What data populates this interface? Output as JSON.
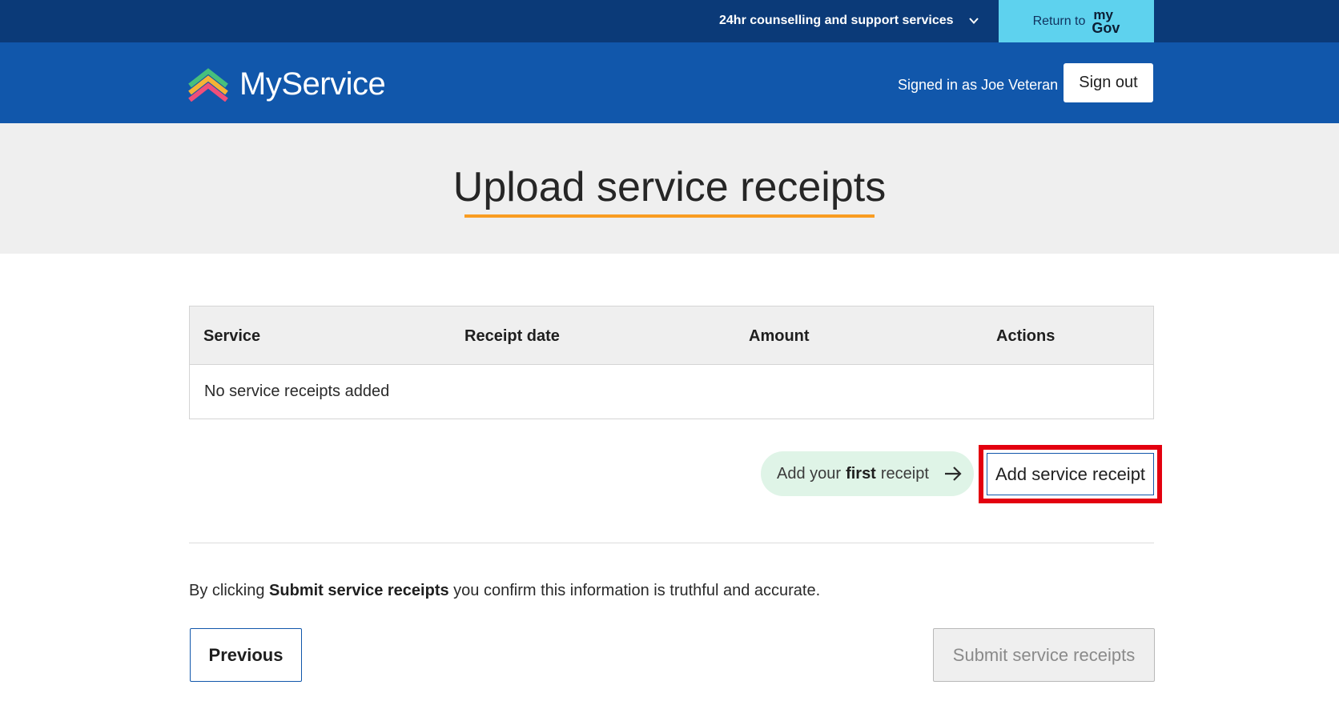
{
  "utility": {
    "counselling_label": "24hr counselling and support services",
    "return_label": "Return to",
    "mygov_top": "my",
    "mygov_bottom": "Gov"
  },
  "header": {
    "brand": "MyService",
    "signed_in": "Signed in as Joe Veteran",
    "signout_label": "Sign out"
  },
  "page": {
    "title": "Upload service receipts"
  },
  "table": {
    "columns": [
      "Service",
      "Receipt date",
      "Amount",
      "Actions"
    ],
    "empty_message": "No service receipts added"
  },
  "actions": {
    "hint_prefix": "Add your",
    "hint_bold": "first",
    "hint_suffix": "receipt",
    "add_label": "Add service receipt"
  },
  "footer": {
    "confirm_prefix": "By clicking",
    "confirm_bold": "Submit service receipts",
    "confirm_suffix": "you confirm this information is truthful and accurate.",
    "previous_label": "Previous",
    "submit_label": "Submit service receipts"
  },
  "colors": {
    "utility_bg": "#0b3a78",
    "brand_bg": "#1157ab",
    "mygov_bg": "#5ed2ee",
    "accent_underline": "#f99d22",
    "hint_bg": "#dff4e7",
    "highlight": "#e3000f"
  },
  "icons": [
    "chevron-down-icon",
    "myservice-logo-icon",
    "arrow-right-icon"
  ]
}
